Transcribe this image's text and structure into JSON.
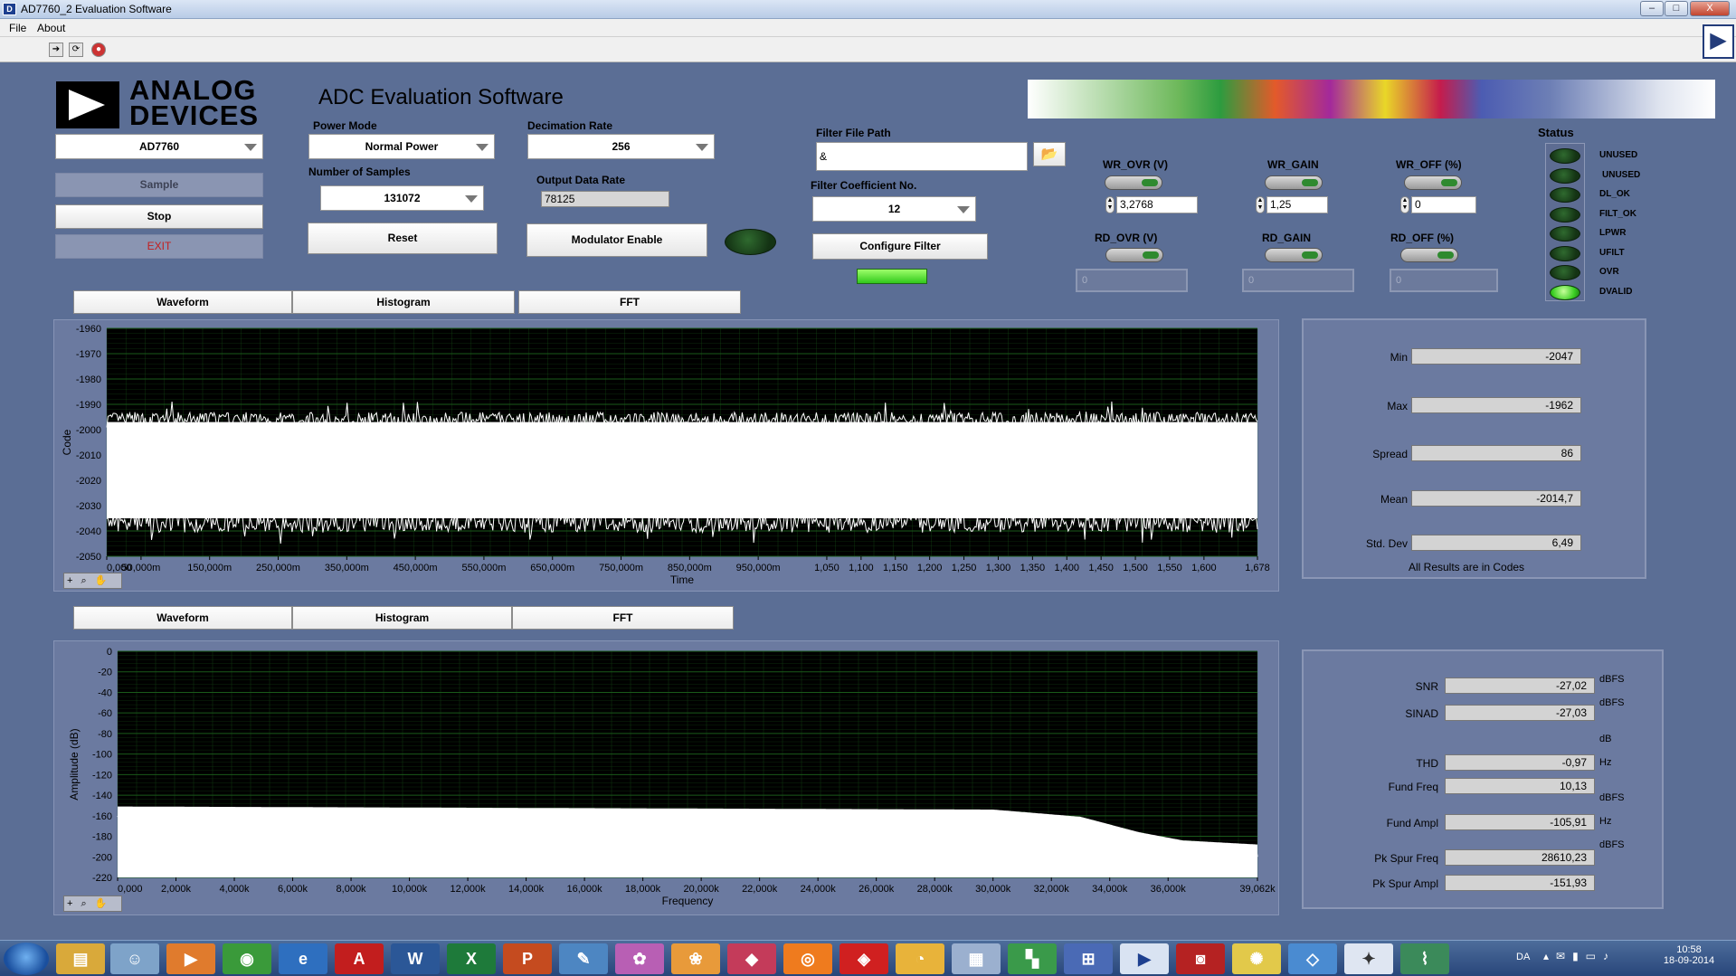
{
  "window": {
    "title": "AD7760_2 Evaluation Software",
    "buttons": [
      "–",
      "□",
      "X"
    ]
  },
  "menu": [
    "File",
    "About"
  ],
  "logo": {
    "line1": "ANALOG",
    "line2": "DEVICES"
  },
  "app_title": "ADC Evaluation Software",
  "device_select": "AD7760",
  "buttons": {
    "sample": "Sample",
    "stop": "Stop",
    "exit": "EXIT",
    "reset": "Reset",
    "modulator_enable": "Modulator Enable",
    "configure_filter": "Configure Filter"
  },
  "power_mode": {
    "label": "Power Mode",
    "value": "Normal Power"
  },
  "num_samples": {
    "label": "Number of Samples",
    "value": "131072"
  },
  "decimation": {
    "label": "Decimation Rate",
    "value": "256"
  },
  "output_rate": {
    "label": "Output Data Rate",
    "value": "78125"
  },
  "filter_path": {
    "label": "Filter File Path",
    "value": "&"
  },
  "filter_coeff": {
    "label": "Filter Coefficient No.",
    "value": "12"
  },
  "registers": {
    "wr_ovr": {
      "label": "WR_OVR (V)",
      "value": "3,2768"
    },
    "wr_gain": {
      "label": "WR_GAIN",
      "value": "1,25"
    },
    "wr_off": {
      "label": "WR_OFF (%)",
      "value": "0"
    },
    "rd_ovr": {
      "label": "RD_OVR (V)",
      "value": "0"
    },
    "rd_gain": {
      "label": "RD_GAIN",
      "value": "0"
    },
    "rd_off": {
      "label": "RD_OFF (%)",
      "value": "0"
    }
  },
  "status": {
    "title": "Status",
    "items": [
      {
        "label": "UNUSED",
        "on": false
      },
      {
        "label": "UNUSED",
        "on": false
      },
      {
        "label": "DL_OK",
        "on": false
      },
      {
        "label": "FILT_OK",
        "on": false
      },
      {
        "label": "LPWR",
        "on": false
      },
      {
        "label": "UFILT",
        "on": false
      },
      {
        "label": "OVR",
        "on": false
      },
      {
        "label": "DVALID",
        "on": true
      }
    ]
  },
  "tabs_top": [
    "Waveform",
    "Histogram",
    "FFT"
  ],
  "tabs_bottom": [
    "Waveform",
    "Histogram",
    "FFT"
  ],
  "zoom_tools": "+ ⌕ ✋",
  "waveform_stats": {
    "items": [
      {
        "label": "Min",
        "value": "-2047"
      },
      {
        "label": "Max",
        "value": "-1962"
      },
      {
        "label": "Spread",
        "value": "86"
      },
      {
        "label": "Mean",
        "value": "-2014,7"
      },
      {
        "label": "Std. Dev",
        "value": "6,49"
      }
    ],
    "note": "All Results are in Codes"
  },
  "fft_stats": {
    "items": [
      {
        "label": "SNR",
        "value": "-27,02",
        "unit": "dBFS"
      },
      {
        "label": "SINAD",
        "value": "-27,03",
        "unit": "dBFS"
      },
      {
        "label": "THD",
        "value": "-0,97",
        "unit": "dB"
      },
      {
        "label": "Fund Freq",
        "value": "10,13",
        "unit": "Hz"
      },
      {
        "label": "Fund Ampl",
        "value": "-105,91",
        "unit": "dBFS"
      },
      {
        "label": "Pk Spur Freq",
        "value": "28610,23",
        "unit": "Hz"
      },
      {
        "label": "Pk Spur Ampl",
        "value": "-151,93",
        "unit": "dBFS"
      }
    ]
  },
  "chart_data": [
    {
      "type": "line",
      "xlabel": "Time",
      "ylabel": "Code",
      "ylim": [
        -2050,
        -1960
      ],
      "ytick_labels": [
        "-1960",
        "-1970",
        "-1980",
        "-1990",
        "-2000",
        "-2010",
        "-2020",
        "-2030",
        "-2040",
        "-2050"
      ],
      "xtick_labels": [
        "0,000",
        "50,000m",
        "150,000m",
        "250,000m",
        "350,000m",
        "450,000m",
        "550,000m",
        "650,000m",
        "750,000m",
        "850,000m",
        "950,000m",
        "1,050",
        "1,100",
        "1,150",
        "1,200",
        "1,250",
        "1,300",
        "1,350",
        "1,400",
        "1,450",
        "1,500",
        "1,550",
        "1,600",
        "1,678"
      ],
      "xtick_values": [
        0,
        0.05,
        0.15,
        0.25,
        0.35,
        0.45,
        0.55,
        0.65,
        0.75,
        0.85,
        0.95,
        1.05,
        1.1,
        1.15,
        1.2,
        1.25,
        1.3,
        1.35,
        1.4,
        1.45,
        1.5,
        1.55,
        1.6,
        1.678
      ],
      "xlim": [
        0,
        1.678
      ],
      "band": {
        "upper_mean": -1997,
        "lower_mean": -2035,
        "upper_spread": 6,
        "lower_spread": 8
      },
      "grid": true,
      "colors": {
        "plot_bg": "#000000",
        "grid": "#1a5a1a",
        "trace": "#ffffff"
      }
    },
    {
      "type": "line",
      "xlabel": "Frequency",
      "ylabel": "Amplitude (dB)",
      "ylim": [
        -220,
        0
      ],
      "ytick_labels": [
        "0",
        "-20",
        "-40",
        "-60",
        "-80",
        "-100",
        "-120",
        "-140",
        "-160",
        "-180",
        "-200",
        "-220"
      ],
      "xtick_labels": [
        "0,000",
        "2,000k",
        "4,000k",
        "6,000k",
        "8,000k",
        "10,000k",
        "12,000k",
        "14,000k",
        "16,000k",
        "18,000k",
        "20,000k",
        "22,000k",
        "24,000k",
        "26,000k",
        "28,000k",
        "30,000k",
        "32,000k",
        "34,000k",
        "36,000k",
        "39,062k"
      ],
      "xtick_values": [
        0,
        2000,
        4000,
        6000,
        8000,
        10000,
        12000,
        14000,
        16000,
        18000,
        20000,
        22000,
        24000,
        26000,
        28000,
        30000,
        32000,
        34000,
        36000,
        39062
      ],
      "xlim": [
        0,
        39062
      ],
      "noise_floor": [
        {
          "x": 0,
          "y": -155
        },
        {
          "x": 30000,
          "y": -158
        },
        {
          "x": 33000,
          "y": -165
        },
        {
          "x": 35000,
          "y": -180
        },
        {
          "x": 36500,
          "y": -188
        },
        {
          "x": 39062,
          "y": -192
        }
      ],
      "grid": true,
      "colors": {
        "plot_bg": "#000000",
        "grid": "#1a5a1a",
        "trace": "#ffffff"
      }
    }
  ]
}
